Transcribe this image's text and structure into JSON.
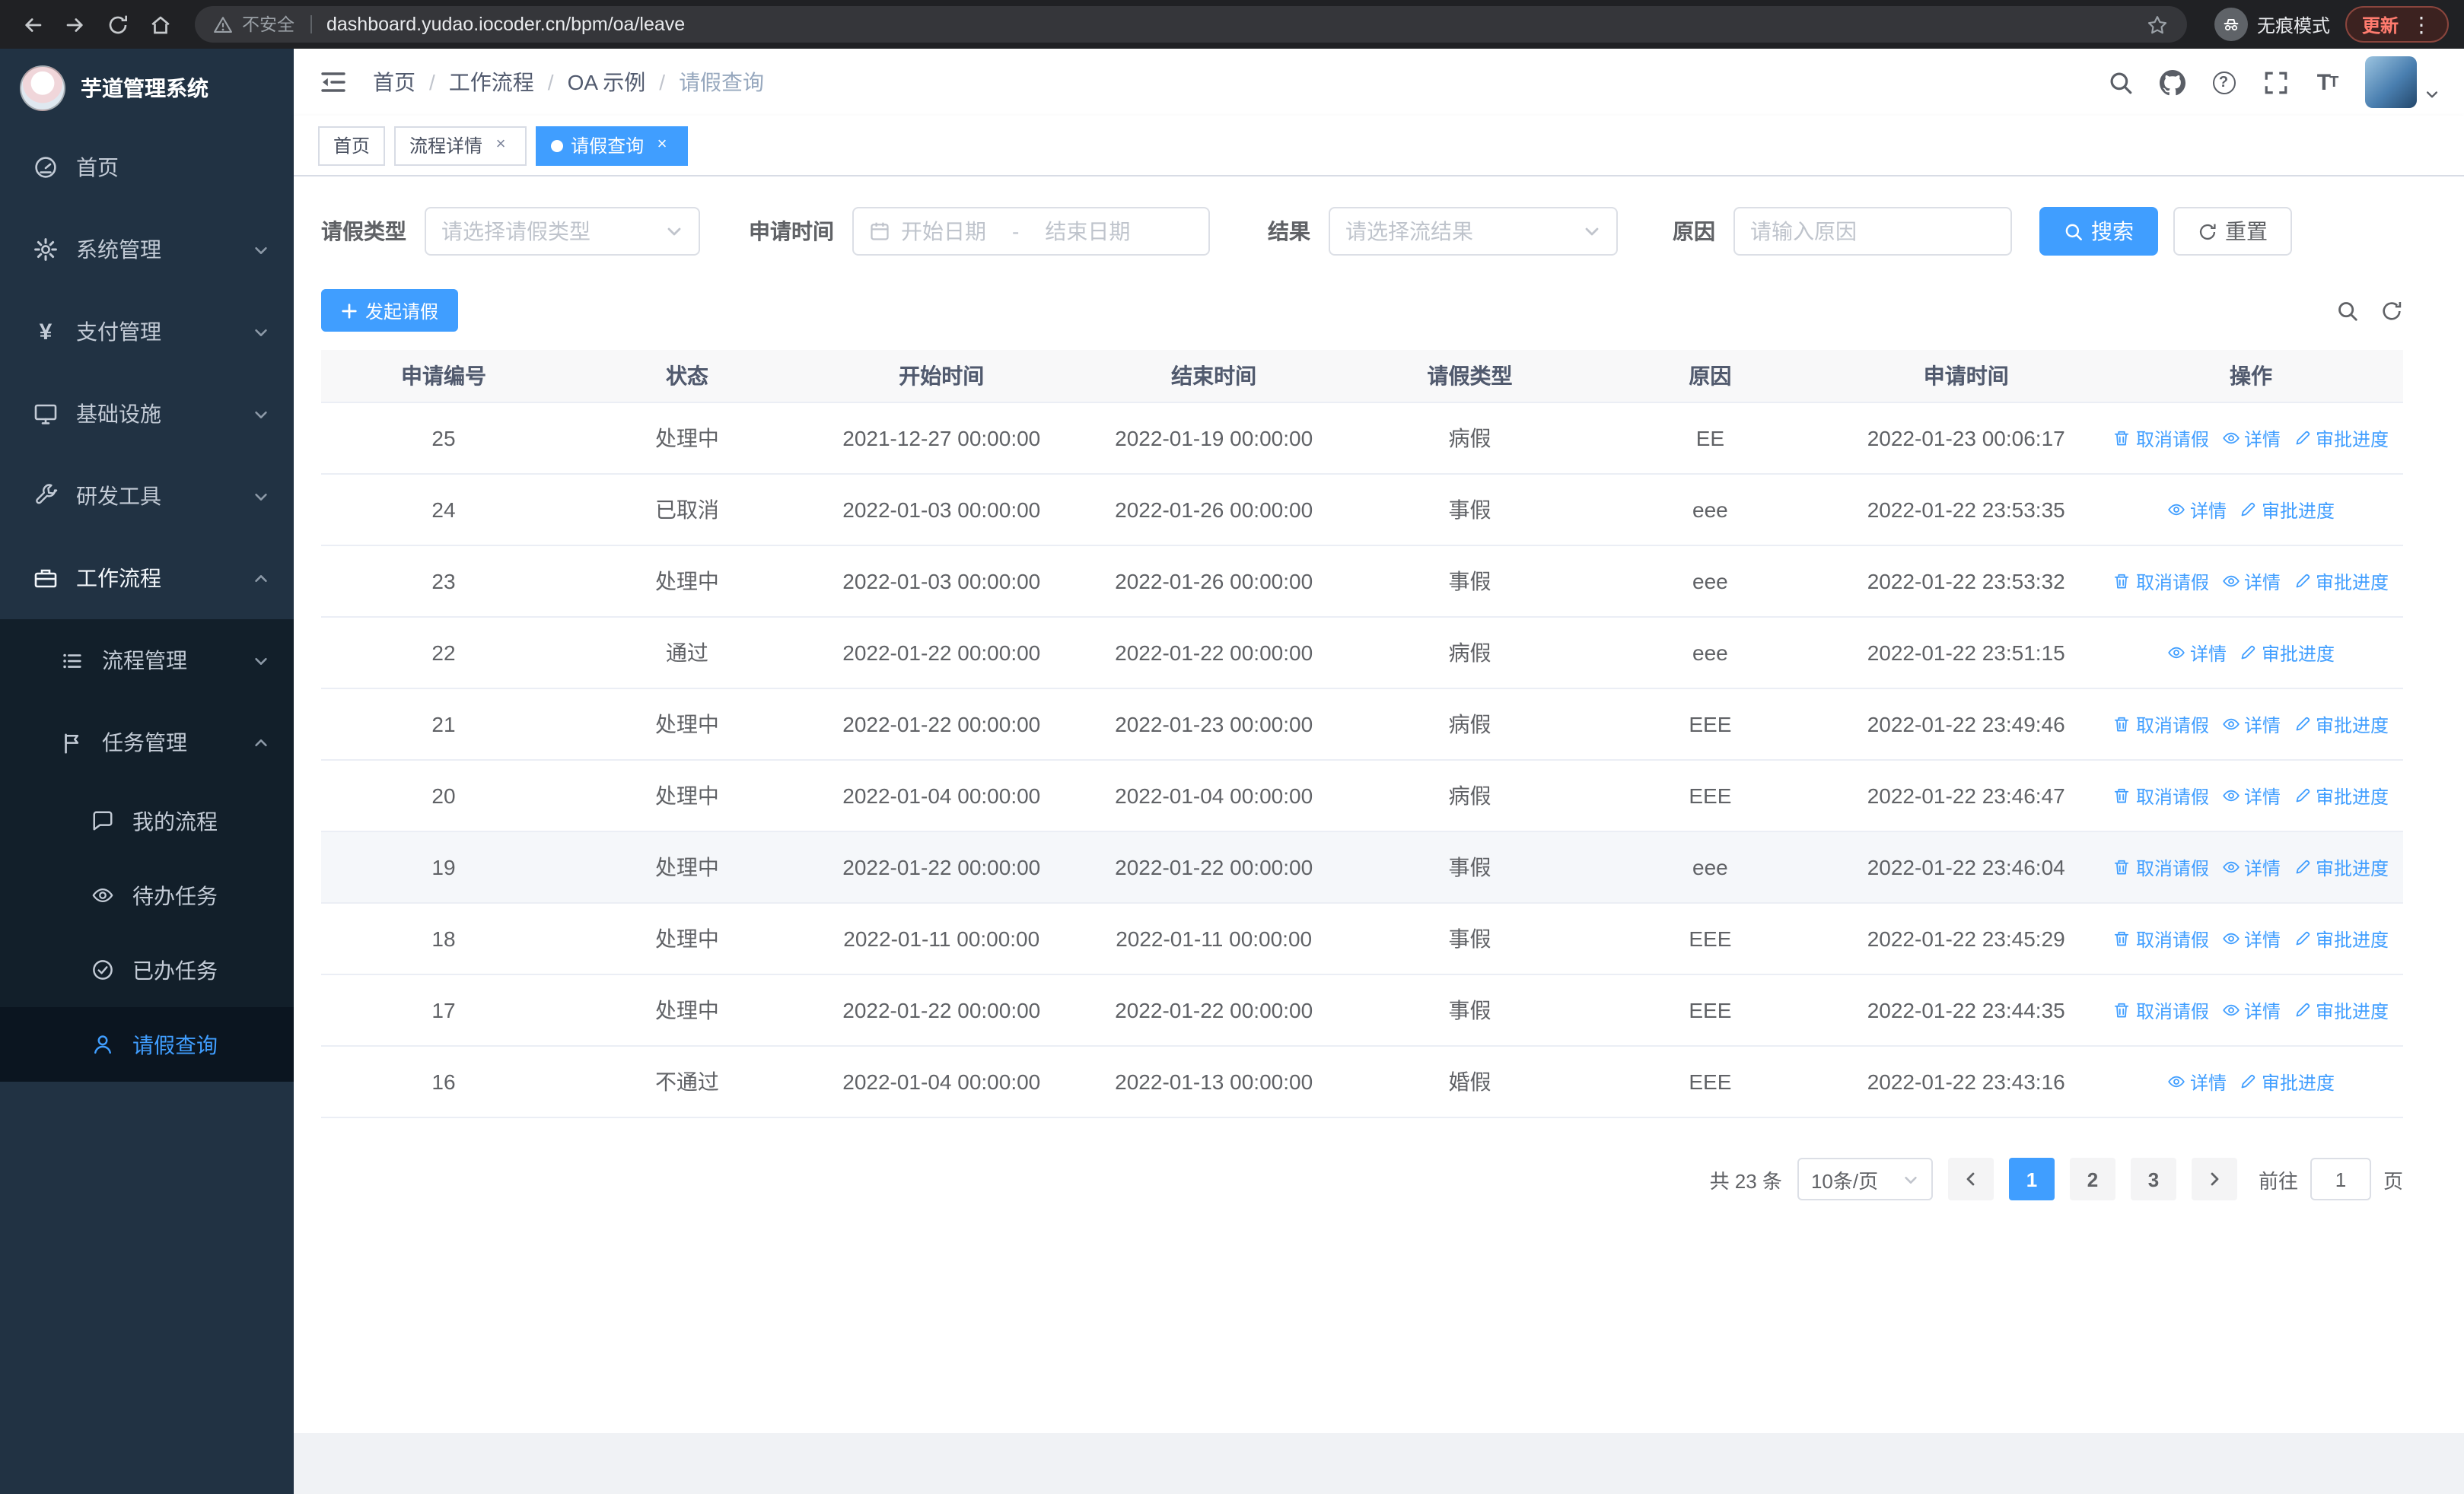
{
  "colors": {
    "primary": "#409eff",
    "sidebar_bg": "#213243",
    "sidebar_sub_bg": "#121f2a"
  },
  "browser": {
    "security_label": "不安全",
    "url": "dashboard.yudao.iocoder.cn/bpm/oa/leave",
    "incognito_label": "无痕模式",
    "update_label": "更新"
  },
  "sidebar": {
    "logo_title": "芋道管理系统",
    "menu": [
      {
        "label": "首页"
      },
      {
        "label": "系统管理"
      },
      {
        "label": "支付管理"
      },
      {
        "label": "基础设施"
      },
      {
        "label": "研发工具"
      },
      {
        "label": "工作流程"
      }
    ],
    "submenu": [
      {
        "label": "流程管理"
      },
      {
        "label": "任务管理"
      }
    ],
    "leaf_menu": [
      {
        "label": "我的流程"
      },
      {
        "label": "待办任务"
      },
      {
        "label": "已办任务"
      },
      {
        "label": "请假查询"
      }
    ]
  },
  "navbar": {
    "breadcrumb": [
      {
        "label": "首页"
      },
      {
        "label": "工作流程"
      },
      {
        "label": "OA 示例"
      },
      {
        "label": "请假查询"
      }
    ]
  },
  "tabs": [
    {
      "label": "首页"
    },
    {
      "label": "流程详情"
    },
    {
      "label": "请假查询"
    }
  ],
  "filters": {
    "leave_type_label": "请假类型",
    "leave_type_placeholder": "请选择请假类型",
    "apply_time_label": "申请时间",
    "start_date_placeholder": "开始日期",
    "range_separator": "-",
    "end_date_placeholder": "结束日期",
    "result_label": "结果",
    "result_placeholder": "请选择流结果",
    "reason_label": "原因",
    "reason_placeholder": "请输入原因",
    "search_label": "搜索",
    "reset_label": "重置"
  },
  "toolbar": {
    "create_label": "发起请假"
  },
  "table": {
    "headers": [
      "申请编号",
      "状态",
      "开始时间",
      "结束时间",
      "请假类型",
      "原因",
      "申请时间",
      "操作"
    ],
    "actions": {
      "cancel": "取消请假",
      "detail": "详情",
      "progress": "审批进度"
    },
    "rows": [
      {
        "id": "25",
        "status": "处理中",
        "start": "2021-12-27 00:00:00",
        "end": "2022-01-19 00:00:00",
        "type": "病假",
        "reason": "EE",
        "applied": "2022-01-23 00:06:17"
      },
      {
        "id": "24",
        "status": "已取消",
        "start": "2022-01-03 00:00:00",
        "end": "2022-01-26 00:00:00",
        "type": "事假",
        "reason": "eee",
        "applied": "2022-01-22 23:53:35"
      },
      {
        "id": "23",
        "status": "处理中",
        "start": "2022-01-03 00:00:00",
        "end": "2022-01-26 00:00:00",
        "type": "事假",
        "reason": "eee",
        "applied": "2022-01-22 23:53:32"
      },
      {
        "id": "22",
        "status": "通过",
        "start": "2022-01-22 00:00:00",
        "end": "2022-01-22 00:00:00",
        "type": "病假",
        "reason": "eee",
        "applied": "2022-01-22 23:51:15"
      },
      {
        "id": "21",
        "status": "处理中",
        "start": "2022-01-22 00:00:00",
        "end": "2022-01-23 00:00:00",
        "type": "病假",
        "reason": "EEE",
        "applied": "2022-01-22 23:49:46"
      },
      {
        "id": "20",
        "status": "处理中",
        "start": "2022-01-04 00:00:00",
        "end": "2022-01-04 00:00:00",
        "type": "病假",
        "reason": "EEE",
        "applied": "2022-01-22 23:46:47"
      },
      {
        "id": "19",
        "status": "处理中",
        "start": "2022-01-22 00:00:00",
        "end": "2022-01-22 00:00:00",
        "type": "事假",
        "reason": "eee",
        "applied": "2022-01-22 23:46:04"
      },
      {
        "id": "18",
        "status": "处理中",
        "start": "2022-01-11 00:00:00",
        "end": "2022-01-11 00:00:00",
        "type": "事假",
        "reason": "EEE",
        "applied": "2022-01-22 23:45:29"
      },
      {
        "id": "17",
        "status": "处理中",
        "start": "2022-01-22 00:00:00",
        "end": "2022-01-22 00:00:00",
        "type": "事假",
        "reason": "EEE",
        "applied": "2022-01-22 23:44:35"
      },
      {
        "id": "16",
        "status": "不通过",
        "start": "2022-01-04 00:00:00",
        "end": "2022-01-13 00:00:00",
        "type": "婚假",
        "reason": "EEE",
        "applied": "2022-01-22 23:43:16"
      }
    ]
  },
  "pagination": {
    "total": "共 23 条",
    "page_size": "10条/页",
    "pages": [
      "1",
      "2",
      "3"
    ],
    "goto_label": "前往",
    "goto_value": "1",
    "unit_label": "页"
  }
}
